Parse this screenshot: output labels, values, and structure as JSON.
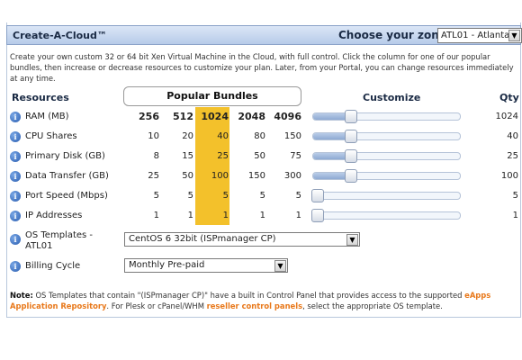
{
  "header": {
    "title": "Create-A-Cloud™",
    "zone_label": "Choose your zone:",
    "zone_value": "ATL01 - Atlanta"
  },
  "intro": "Create your own custom 32 or 64 bit Xen Virtual Machine in the Cloud, with full control. Click the column for one of our popular bundles, then increase or decrease resources to customize your plan. Later, from your Portal, you can change resources immediately at any time.",
  "columns": {
    "resources": "Resources",
    "bundles": "Popular Bundles",
    "customize": "Customize",
    "qty": "Qty"
  },
  "rows": [
    {
      "label": "RAM (MB)",
      "values": [
        "256",
        "512",
        "1024",
        "2048",
        "4096"
      ],
      "qty": "1024",
      "slider_fraction": 0.26
    },
    {
      "label": "CPU Shares",
      "values": [
        "10",
        "20",
        "40",
        "80",
        "150"
      ],
      "qty": "40",
      "slider_fraction": 0.26
    },
    {
      "label": "Primary Disk (GB)",
      "values": [
        "8",
        "15",
        "25",
        "50",
        "75"
      ],
      "qty": "25",
      "slider_fraction": 0.26
    },
    {
      "label": "Data Transfer (GB)",
      "values": [
        "25",
        "50",
        "100",
        "150",
        "300"
      ],
      "qty": "100",
      "slider_fraction": 0.26
    },
    {
      "label": "Port Speed (Mbps)",
      "values": [
        "5",
        "5",
        "5",
        "5",
        "5"
      ],
      "qty": "5",
      "slider_fraction": 0.0
    },
    {
      "label": "IP Addresses",
      "values": [
        "1",
        "1",
        "1",
        "1",
        "1"
      ],
      "qty": "1",
      "slider_fraction": 0.0
    }
  ],
  "selected_bundle_index": 2,
  "os_templates": {
    "label": "OS Templates - ATL01",
    "value": "CentOS 6 32bit (ISPmanager CP)"
  },
  "billing": {
    "label": "Billing Cycle",
    "value": "Monthly Pre-paid"
  },
  "note": {
    "prefix": "Note:",
    "text1": " OS Templates that contain \"(ISPmanager CP)\" have a built in Control Panel that provides access to the supported ",
    "link1": "eApps Application Repository",
    "text2": ". For Plesk or cPanel/WHM ",
    "link2": "reseller control panels",
    "text3": ", select the appropriate OS template."
  }
}
